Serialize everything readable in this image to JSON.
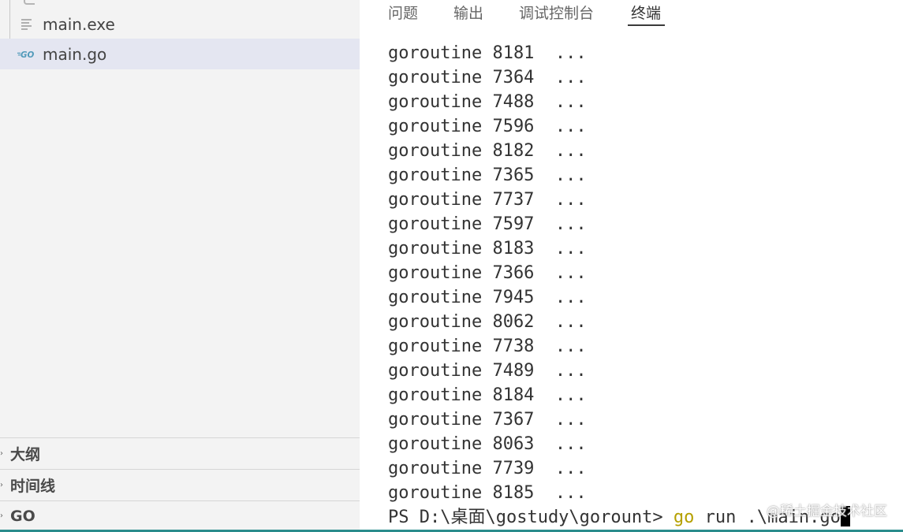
{
  "explorer": {
    "files": [
      {
        "name": "main.exe",
        "icon": "text-file-icon"
      },
      {
        "name": "main.go",
        "icon": "go-file-icon",
        "icon_text": "GO",
        "selected": true
      }
    ],
    "sections": [
      {
        "label": "大纲"
      },
      {
        "label": "时间线"
      },
      {
        "label": "GO"
      }
    ]
  },
  "panel": {
    "tabs": [
      {
        "label": "问题"
      },
      {
        "label": "输出"
      },
      {
        "label": "调试控制台"
      },
      {
        "label": "终端",
        "active": true
      }
    ]
  },
  "terminal": {
    "lines": [
      "goroutine 8181  ...",
      "goroutine 7364  ...",
      "goroutine 7488  ...",
      "goroutine 7596  ...",
      "goroutine 8182  ...",
      "goroutine 7365  ...",
      "goroutine 7737  ...",
      "goroutine 7597  ...",
      "goroutine 8183  ...",
      "goroutine 7366  ...",
      "goroutine 7945  ...",
      "goroutine 8062  ...",
      "goroutine 7738  ...",
      "goroutine 7489  ...",
      "goroutine 8184  ...",
      "goroutine 7367  ...",
      "goroutine 8063  ...",
      "goroutine 7739  ...",
      "goroutine 8185  ..."
    ],
    "prompt": {
      "path": "PS D:\\桌面\\gostudy\\gorount> ",
      "command": "go",
      "args": " run .\\main.go"
    }
  },
  "watermark": "@稀土掘金技术社区",
  "colors": {
    "sidebar_bg": "#f3f3f3",
    "selected_row": "#e4e6f1",
    "go_keyword": "#b5a000",
    "go_icon": "#519aba",
    "status_strip": "#2a8c8c"
  }
}
